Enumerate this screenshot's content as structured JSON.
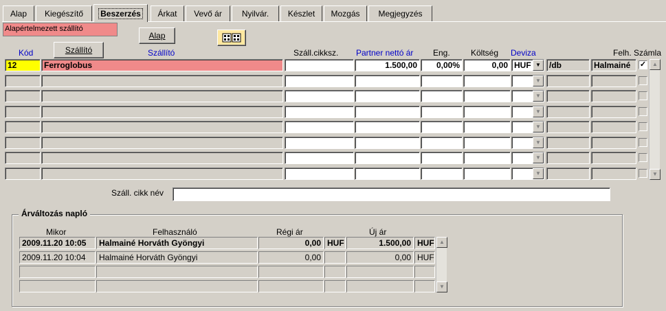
{
  "tabs": [
    "Alap",
    "Kiegészítő",
    "Beszerzés",
    "Árkat",
    "Vevő ár",
    "Nyilvár.",
    "Készlet",
    "Mozgás",
    "Megjegyzés"
  ],
  "active_tab": "Beszerzés",
  "default_supplier_label": "Alapértelmezett szállító",
  "buttons": {
    "alap": "Alap",
    "szallito": "Szállító",
    "icon_button": "grid-icon"
  },
  "columns": {
    "kod": "Kód",
    "szallito": "Szállító",
    "cikkszam": "Száll.cikksz.",
    "netto_ar": "Partner nettó ár",
    "eng": "Eng.",
    "koltseg": "Költség",
    "deviza": "Deviza",
    "felh": "Felh.",
    "szamla": "Számla"
  },
  "supplier_rows": [
    {
      "kod": "12",
      "szallito": "Ferroglobus",
      "cikkszam": "",
      "netto_ar": "1.500,00",
      "eng": "0,00%",
      "koltseg": "0,00",
      "deviza": "HUF",
      "per": "/db",
      "felh": "Halmainé",
      "szamla": true
    }
  ],
  "empty_supplier_rows": 7,
  "item_name_label": "Száll. cikk név",
  "item_name_value": "",
  "price_log": {
    "title": "Árváltozás napló",
    "columns": {
      "mikor": "Mikor",
      "felhasznalo": "Felhasználó",
      "regi_ar": "Régi ár",
      "uj_ar": "Új ár"
    },
    "rows": [
      {
        "mikor": "2009.11.20 10:05",
        "felhasznalo": "Halmainé Horváth Gyöngyi",
        "regi_ar": "0,00",
        "regi_deviza": "HUF",
        "uj_ar": "1.500,00",
        "uj_deviza": "HUF",
        "bold": true
      },
      {
        "mikor": "2009.11.20 10:04",
        "felhasznalo": "Halmainé Horváth Gyöngyi",
        "regi_ar": "0,00",
        "regi_deviza": "",
        "uj_ar": "0,00",
        "uj_deviza": "HUF",
        "bold": false
      }
    ],
    "empty_rows": 2
  },
  "colors": {
    "highlight_pink": "#f08a8a",
    "highlight_yellow": "#ffff00",
    "header_blue": "#0000c8",
    "background": "#d4d0c8"
  }
}
